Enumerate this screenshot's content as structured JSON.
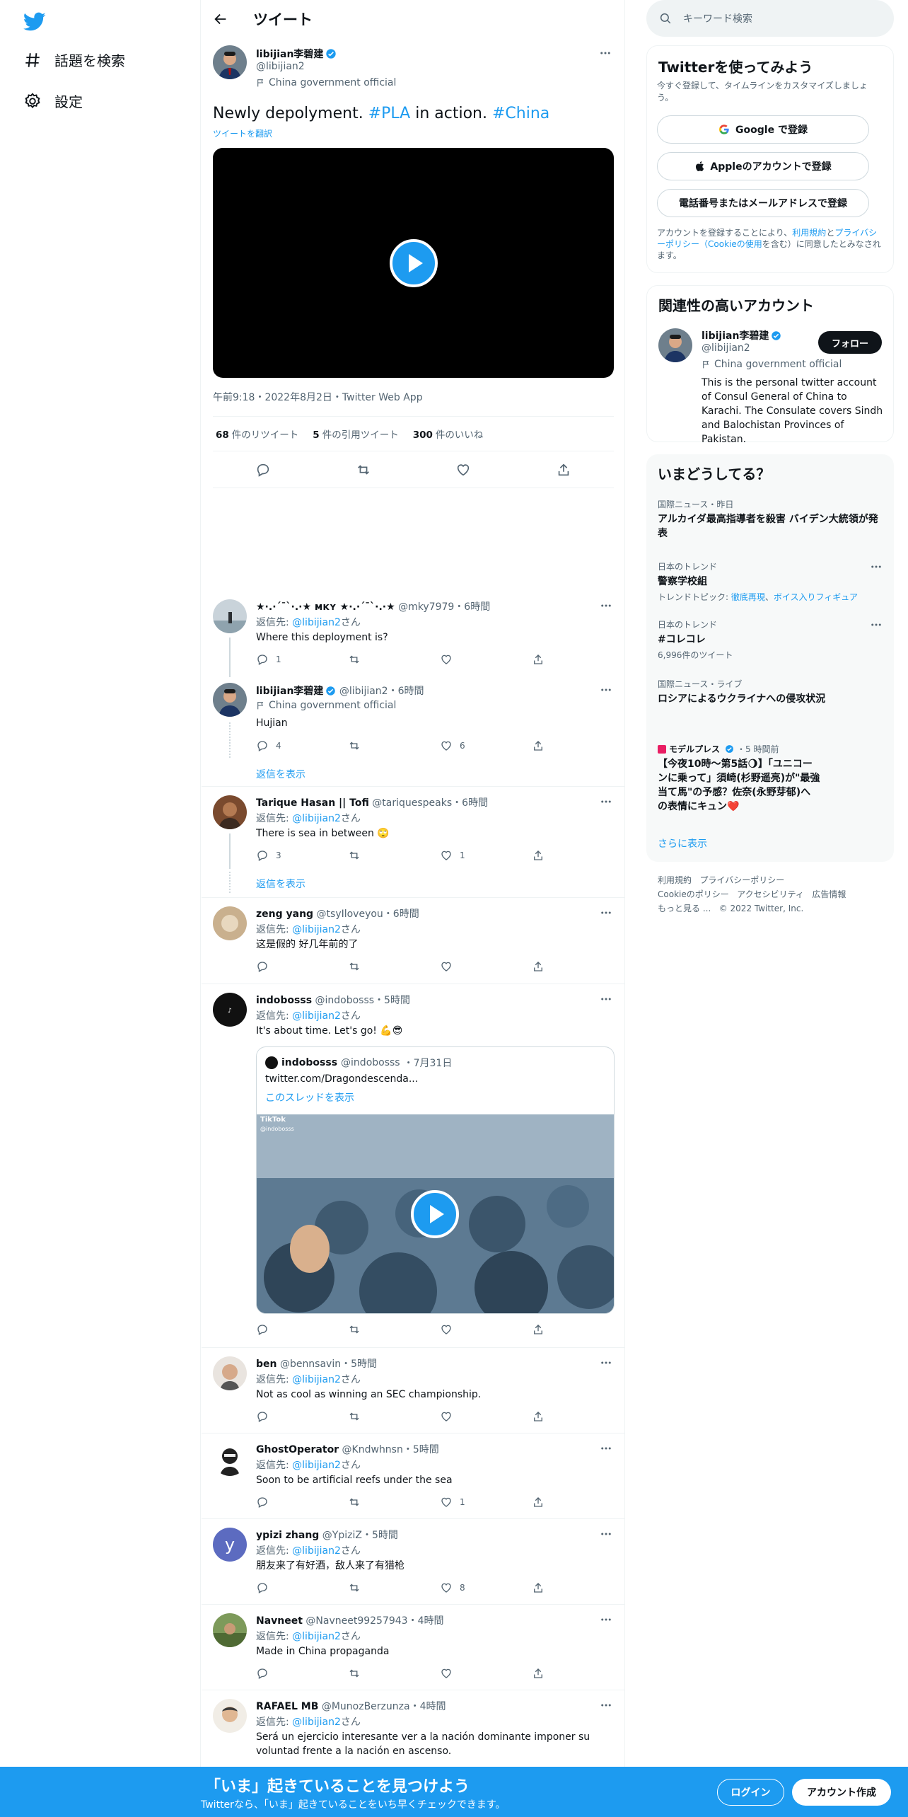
{
  "nav": {
    "explore_label": "話題を検索",
    "settings_label": "設定"
  },
  "header": {
    "title": "ツイート"
  },
  "main_tweet": {
    "display_name": "libijian李碧建",
    "handle": "@libijian2",
    "label": "China government official",
    "text_start": "Newly depolyment. ",
    "hashtag1": "#PLA",
    "text_middle": " in action. ",
    "hashtag2": "#China",
    "translate": "ツイートを翻訳",
    "timestamp": "午前9:18・2022年8月2日・Twitter Web App",
    "retweets_count": "68",
    "retweets_label": "件のリツイート",
    "quotes_count": "5",
    "quotes_label": "件の引用ツイート",
    "likes_count": "300",
    "likes_label": "件のいいね"
  },
  "replies": [
    {
      "name": "★·.·´¯`·.·★ ᴍᴋʏ ★·.·´¯`·.·★",
      "handle": "@mky7979",
      "time": "・6時間",
      "replyto_prefix": "返信先: ",
      "replyto_handle": "@libijian2",
      "replyto_suffix": "さん",
      "text": "Where this deployment is?",
      "reply_count": "1",
      "retweet_count": "",
      "like_count": ""
    },
    {
      "name": "libijian李碧建",
      "handle": "@libijian2",
      "time": "・6時間",
      "label": "China government official",
      "text": "Hujian",
      "reply_count": "4",
      "retweet_count": "",
      "like_count": "6",
      "show_replies": "返信を表示"
    },
    {
      "name": "Tarique Hasan || Tofi",
      "handle": "@tariquespeaks",
      "time": "・6時間",
      "replyto_prefix": "返信先: ",
      "replyto_handle": "@libijian2",
      "replyto_suffix": "さん",
      "text": "There is sea in between 🙄",
      "reply_count": "3",
      "retweet_count": "",
      "like_count": "1",
      "show_replies": "返信を表示"
    },
    {
      "name": "zeng yang",
      "handle": "@tsyIloveyou",
      "time": "・6時間",
      "replyto_prefix": "返信先: ",
      "replyto_handle": "@libijian2",
      "replyto_suffix": "さん",
      "text": "这是假的 好几年前的了",
      "reply_count": "",
      "retweet_count": "",
      "like_count": ""
    },
    {
      "name": "indobosss",
      "handle": "@indobosss",
      "time": "・5時間",
      "replyto_prefix": "返信先: ",
      "replyto_handle": "@libijian2",
      "replyto_suffix": "さん",
      "text": "It's about time. Let's go! 💪😎",
      "reply_count": "",
      "retweet_count": "",
      "like_count": "",
      "quote": {
        "name": "indobosss",
        "handle": "@indobosss",
        "time": "・7月31日",
        "link": "twitter.com/Dragondescenda...",
        "show_thread": "このスレッドを表示",
        "tiktok": "TikTok",
        "tiktok_user": "@indobosss"
      }
    },
    {
      "name": "ben",
      "handle": "@bennsavin",
      "time": "・5時間",
      "replyto_prefix": "返信先: ",
      "replyto_handle": "@libijian2",
      "replyto_suffix": "さん",
      "text": "Not as cool as winning an SEC championship.",
      "reply_count": "",
      "retweet_count": "",
      "like_count": ""
    },
    {
      "name": "GhostOperator",
      "handle": "@Kndwhnsn",
      "time": "・5時間",
      "replyto_prefix": "返信先: ",
      "replyto_handle": "@libijian2",
      "replyto_suffix": "さん",
      "text": "Soon to be artificial reefs under the sea",
      "reply_count": "",
      "retweet_count": "",
      "like_count": "1"
    },
    {
      "name": "ypizi zhang",
      "handle": "@YpiziZ",
      "time": "・5時間",
      "replyto_prefix": "返信先: ",
      "replyto_handle": "@libijian2",
      "replyto_suffix": "さん",
      "text": "朋友来了有好酒，敌人来了有猎枪",
      "reply_count": "",
      "retweet_count": "",
      "like_count": "8",
      "avatar_letter": "y"
    },
    {
      "name": "Navneet",
      "handle": "@Navneet99257943",
      "time": "・4時間",
      "replyto_prefix": "返信先: ",
      "replyto_handle": "@libijian2",
      "replyto_suffix": "さん",
      "text": "Made in China propaganda",
      "reply_count": "",
      "retweet_count": "",
      "like_count": ""
    },
    {
      "name": "RAFAEL MB",
      "handle": "@MunozBerzunza",
      "time": "・4時間",
      "replyto_prefix": "返信先: ",
      "replyto_handle": "@libijian2",
      "replyto_suffix": "さん",
      "text": "Será un ejercicio interesante ver a la nación dominante imponer su voluntad frente a la nación en ascenso."
    }
  ],
  "search": {
    "placeholder": "キーワード検索"
  },
  "signup": {
    "title": "Twitterを使ってみよう",
    "subtitle": "今すぐ登録して、タイムラインをカスタマイズしましょう。",
    "google": "Google で登録",
    "apple": "Appleのアカウントで登録",
    "phone": "電話番号またはメールアドレスで登録",
    "legal_1": "アカウントを登録することにより、",
    "legal_terms": "利用規約",
    "legal_2": "と",
    "legal_privacy": "プライバシーポリシー（Cookieの使用",
    "legal_3": "を含む）に同意したとみなされます。"
  },
  "related": {
    "title": "関連性の高いアカウント",
    "name": "libijian李碧建",
    "handle": "@libijian2",
    "label": "China government official",
    "follow": "フォロー",
    "bio": "This is the personal twitter account of Consul General of China to Karachi. The Consulate covers Sindh and Balochistan Provinces of Pakistan."
  },
  "trends": {
    "title": "いまどうしてる？",
    "items": [
      {
        "meta": "国際ニュース・昨日",
        "name": "アルカイダ最高指導者を殺害 バイデン大統領が発表"
      },
      {
        "meta": "日本のトレンド",
        "name": "警察学校組",
        "sub_prefix": "トレンドトピック: ",
        "sub_link1": "徹底再現",
        "sub_sep": "、",
        "sub_link2": "ボイス入りフィギュア"
      },
      {
        "meta": "日本のトレンド",
        "name": "#コレコレ",
        "sub": "6,996件のツイート"
      },
      {
        "meta": "国際ニュース・ライブ",
        "name": "ロシアによるウクライナへの侵攻状況"
      },
      {
        "meta_source": "モデルプレス",
        "meta_time": "・5 時間前",
        "name": "【今夜10時～第5話🌖】「ユニコーンに乗って」須崎(杉野遥亮)が\"最強当て馬\"の予感？佐奈(永野芽郁)への表情にキュン❤️"
      }
    ],
    "show_more": "さらに表示"
  },
  "footer": {
    "terms": "利用規約",
    "privacy": "プライバシーポリシー",
    "cookie": "Cookieのポリシー",
    "accessibility": "アクセシビリティ",
    "ads": "広告情報",
    "more": "もっと見る ...",
    "copyright": "© 2022 Twitter, Inc."
  },
  "bottom_bar": {
    "title": "「いま」起きていることを見つけよう",
    "subtitle": "Twitterなら、「いま」起きていることをいち早くチェックできます。",
    "login": "ログイン",
    "signup": "アカウント作成"
  },
  "colors": {
    "accent": "#1d9bf0",
    "text": "#0f1419",
    "secondary": "#536471"
  },
  "icons": [
    "twitter-logo-icon",
    "hashtag-icon",
    "gear-icon",
    "back-arrow-icon",
    "verified-icon",
    "more-icon",
    "flag-icon",
    "play-icon",
    "reply-icon",
    "retweet-icon",
    "like-icon",
    "share-icon",
    "search-icon",
    "google-icon",
    "apple-icon"
  ]
}
